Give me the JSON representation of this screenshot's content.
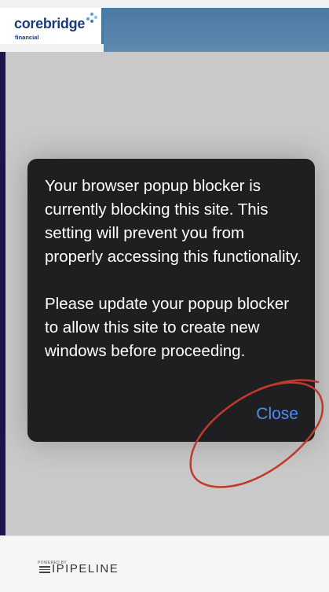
{
  "header": {
    "logo_text": "corebridge",
    "logo_subtext": "financial"
  },
  "dialog": {
    "message_paragraph_1": "Your browser popup blocker is currently blocking this site. This setting will prevent you from properly accessing this functionality.",
    "message_paragraph_2": "Please update your popup blocker to allow this site to create new windows before proceeding.",
    "close_label": "Close",
    "close_color": "#4d8ef0",
    "background_color": "#1f1f22"
  },
  "footer": {
    "powered_by": "POWERED BY",
    "brand": "IPIPELINE"
  },
  "annotation": {
    "type": "hand-drawn-circle",
    "color": "#c0392b"
  }
}
